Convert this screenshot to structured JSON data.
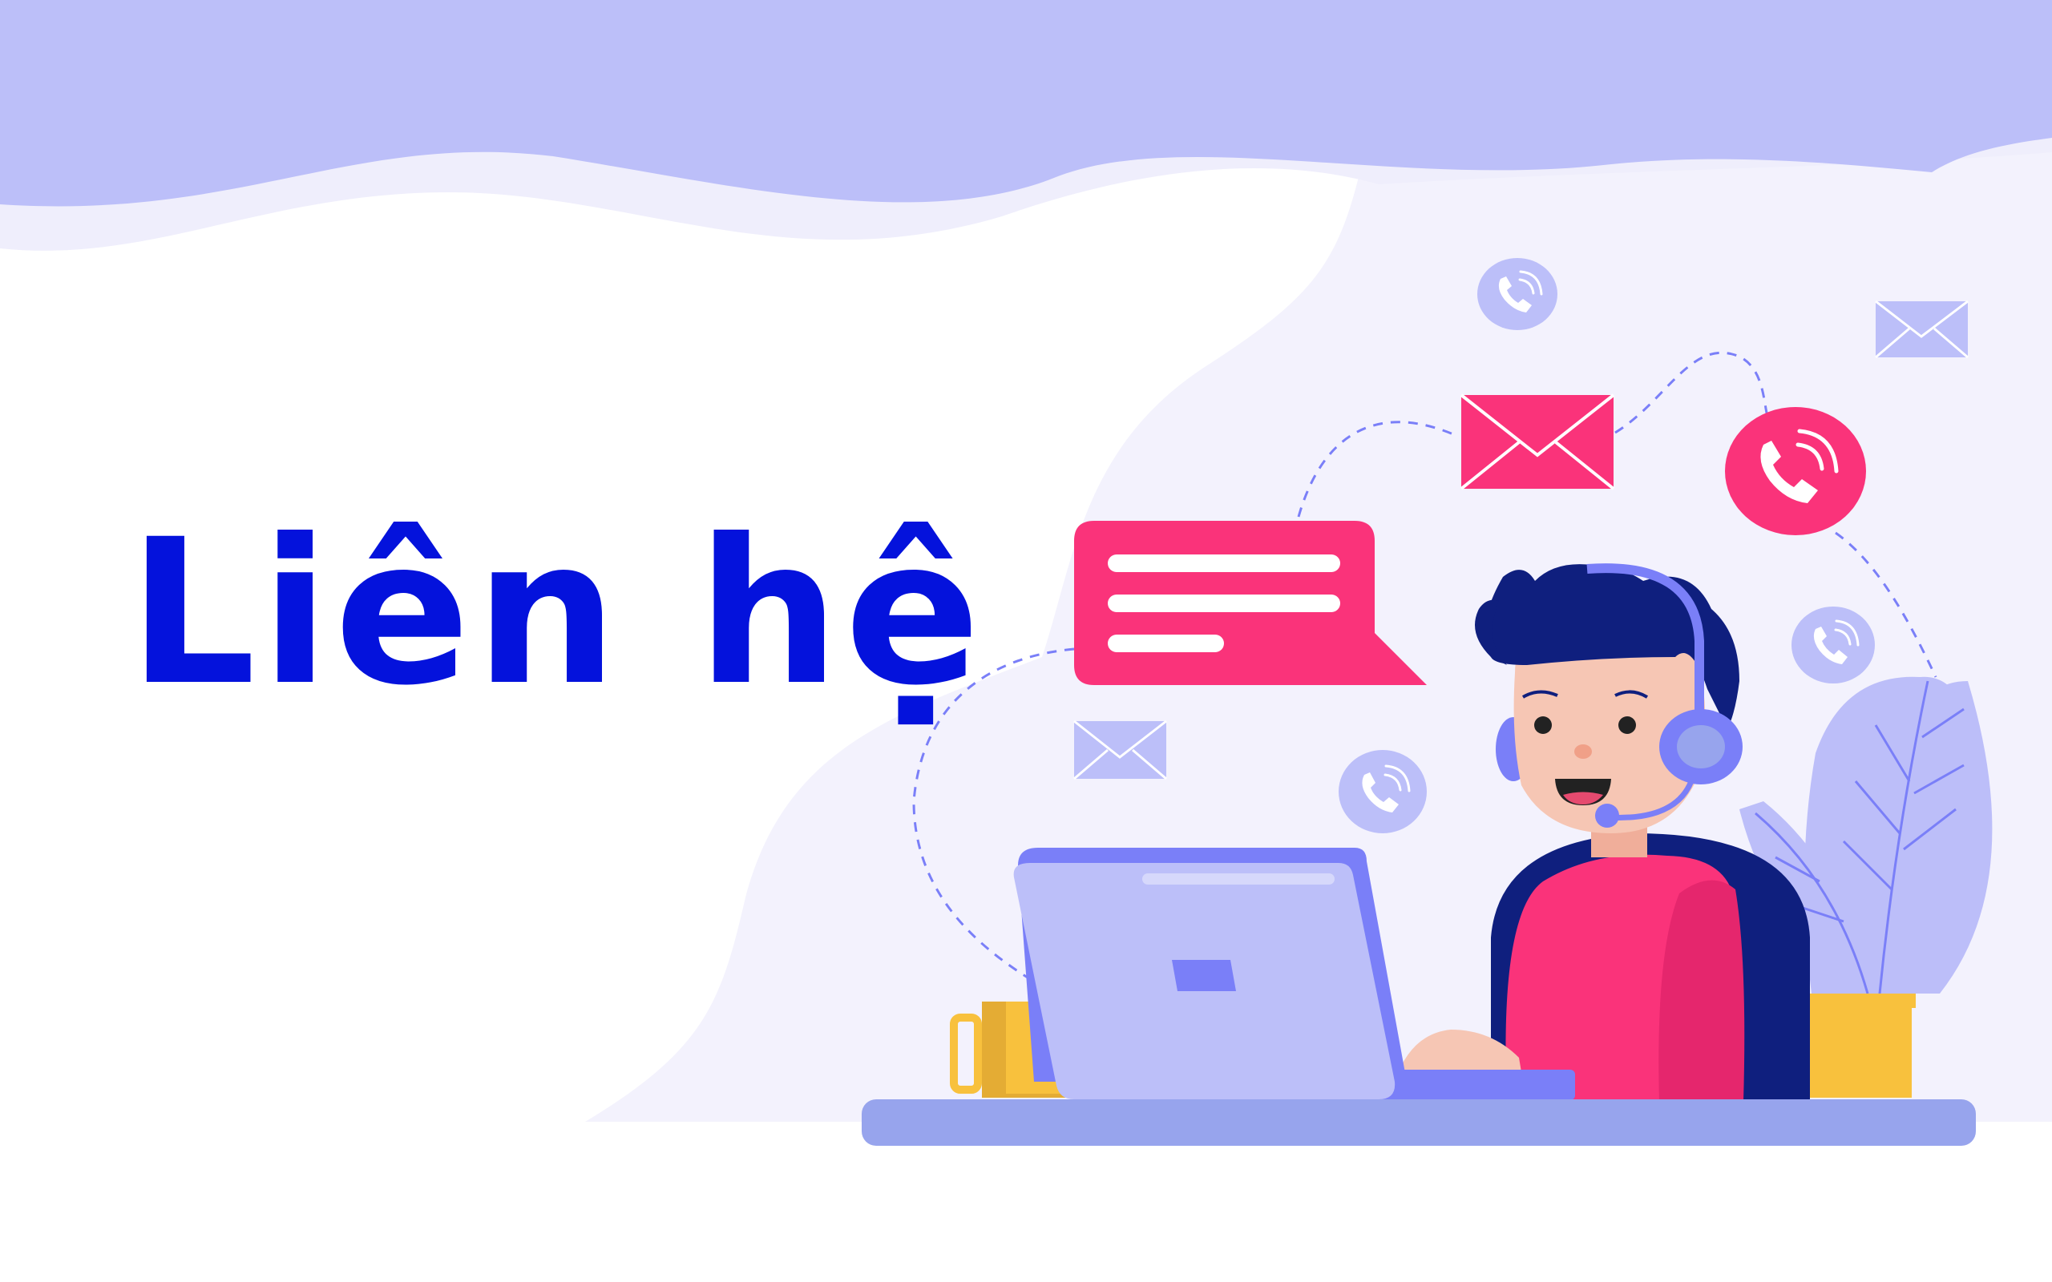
{
  "banner": {
    "title": "Liên hệ"
  },
  "colors": {
    "title": "#0412dc",
    "top_wave": "#bcbff9",
    "pale_blob": "#f3f2fd",
    "pink": "#fa337a",
    "pink_dark": "#e5266d",
    "navy": "#0f1f7e",
    "lavender": "#bcbef9",
    "purple": "#7a7ff8",
    "desk": "#97a4ed",
    "skin": "#f6c6b4",
    "yellow": "#f8c13d",
    "yellow_dark": "#e4ac34"
  },
  "icons": [
    "phone-icon",
    "envelope-icon",
    "chat-bubble-icon",
    "headset-icon",
    "laptop-icon",
    "mug-icon",
    "plant-icon"
  ]
}
